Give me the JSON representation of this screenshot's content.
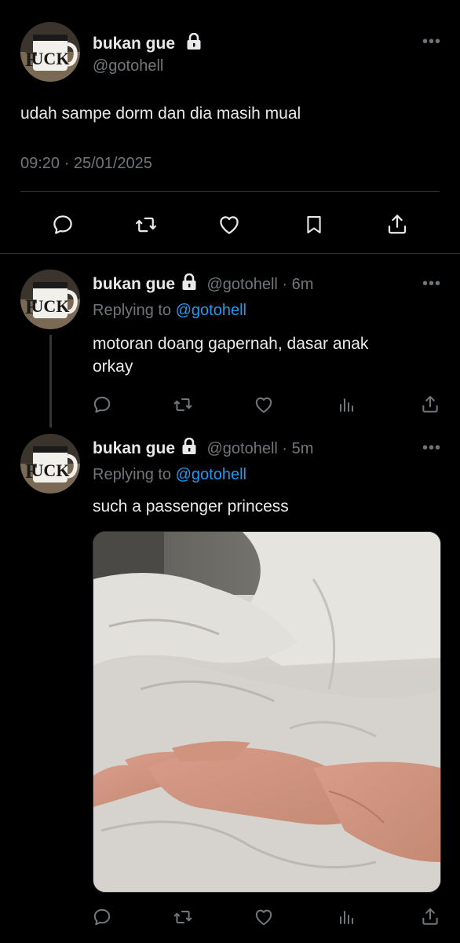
{
  "main_tweet": {
    "display_name": "bukan gue",
    "handle": "@gotohell",
    "text": "udah sampe dorm dan dia masih mual",
    "timestamp": "09:20 · 25/01/2025"
  },
  "replies": [
    {
      "display_name": "bukan gue",
      "handle_time": "@gotohell · 6m",
      "replying_prefix": "Replying to",
      "replying_mention": "@gotohell",
      "text_line1": "motoran doang gapernah, dasar anak",
      "text_line2": "orkay"
    },
    {
      "display_name": "bukan gue",
      "handle_time": "@gotohell · 5m",
      "replying_prefix": "Replying to",
      "replying_mention": "@gotohell",
      "text_line1": "such a passenger princess",
      "has_image": true
    }
  ],
  "icons": {
    "reply": "reply-icon",
    "retweet": "retweet-icon",
    "like": "like-icon",
    "bookmark": "bookmark-icon",
    "share": "share-icon",
    "views": "views-icon",
    "more": "more-icon",
    "lock": "lock-icon"
  },
  "colors": {
    "background": "#000000",
    "text": "#e7e9ea",
    "muted": "#71767b",
    "mention": "#1d9bf0",
    "divider": "#2f3336"
  }
}
